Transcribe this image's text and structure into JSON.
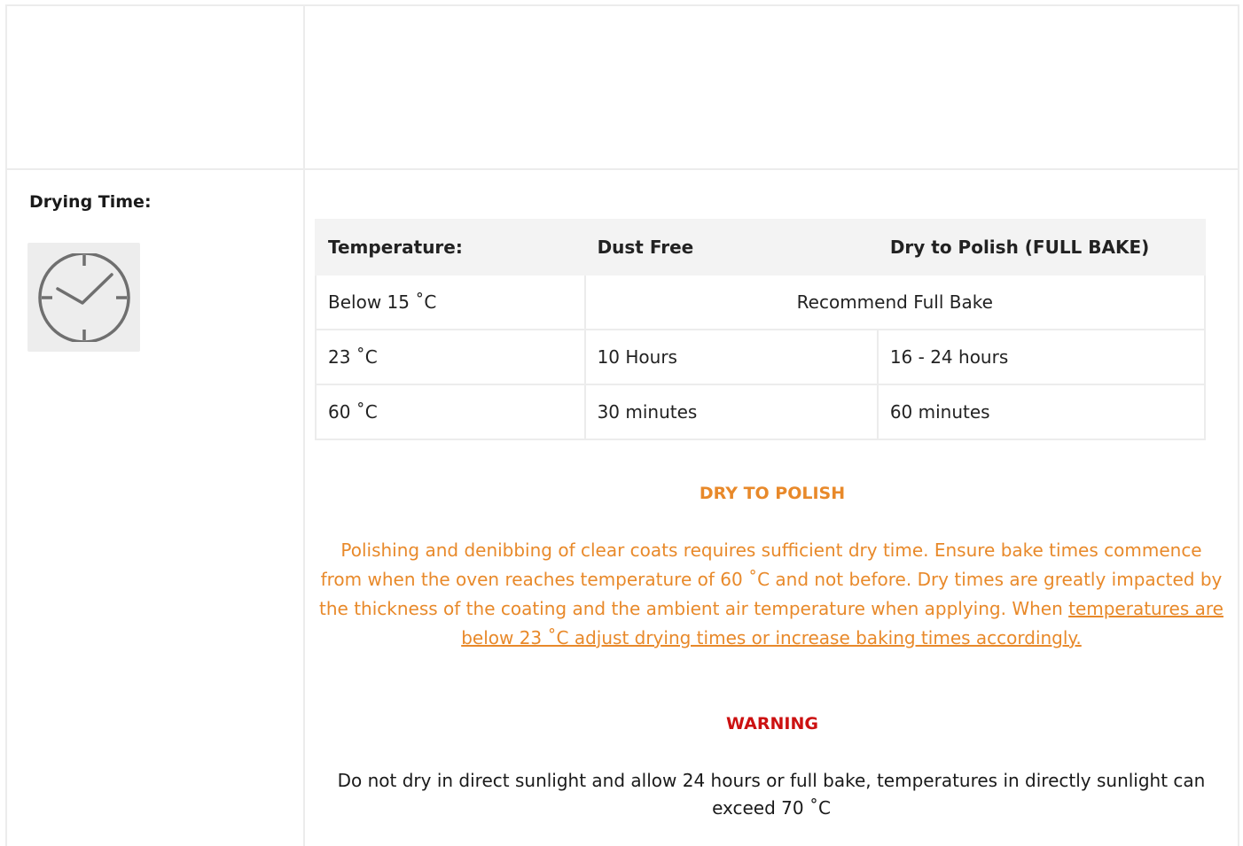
{
  "section": {
    "label": "Drying Time:",
    "icon": "clock-icon"
  },
  "table": {
    "headers": [
      "Temperature:",
      "Dust Free",
      "Dry to Polish (FULL BAKE)"
    ],
    "rows": [
      {
        "temperature": "Below 15 ˚C",
        "merged": "Recommend Full Bake"
      },
      {
        "temperature": "23 ˚C",
        "dust_free": "10 Hours",
        "dry_to_polish": "16 - 24 hours"
      },
      {
        "temperature": "60 ˚C",
        "dust_free": "30  minutes",
        "dry_to_polish": "60 minutes"
      }
    ]
  },
  "dry_to_polish": {
    "title": "DRY TO POLISH",
    "body": "Polishing and denibbing of clear coats requires sufficient dry time. Ensure bake times commence from when the oven reaches temperature of 60 ˚C and not before.  Dry times are greatly impacted by the thickness of the coating and the ambient air temperature when applying. When ",
    "link": "temperatures are below 23 ˚C adjust drying times or increase baking times accordingly."
  },
  "warning": {
    "title": "WARNING",
    "body": "Do not dry in direct sunlight and allow 24 hours or full bake, temperatures in directly sunlight can exceed  70 ˚C"
  },
  "colors": {
    "accent_orange": "#e8892a",
    "warning_red": "#cc1111",
    "border": "#ececec",
    "header_bg": "#f3f3f3",
    "icon_bg": "#ededed",
    "icon_stroke": "#6f6f6f"
  }
}
